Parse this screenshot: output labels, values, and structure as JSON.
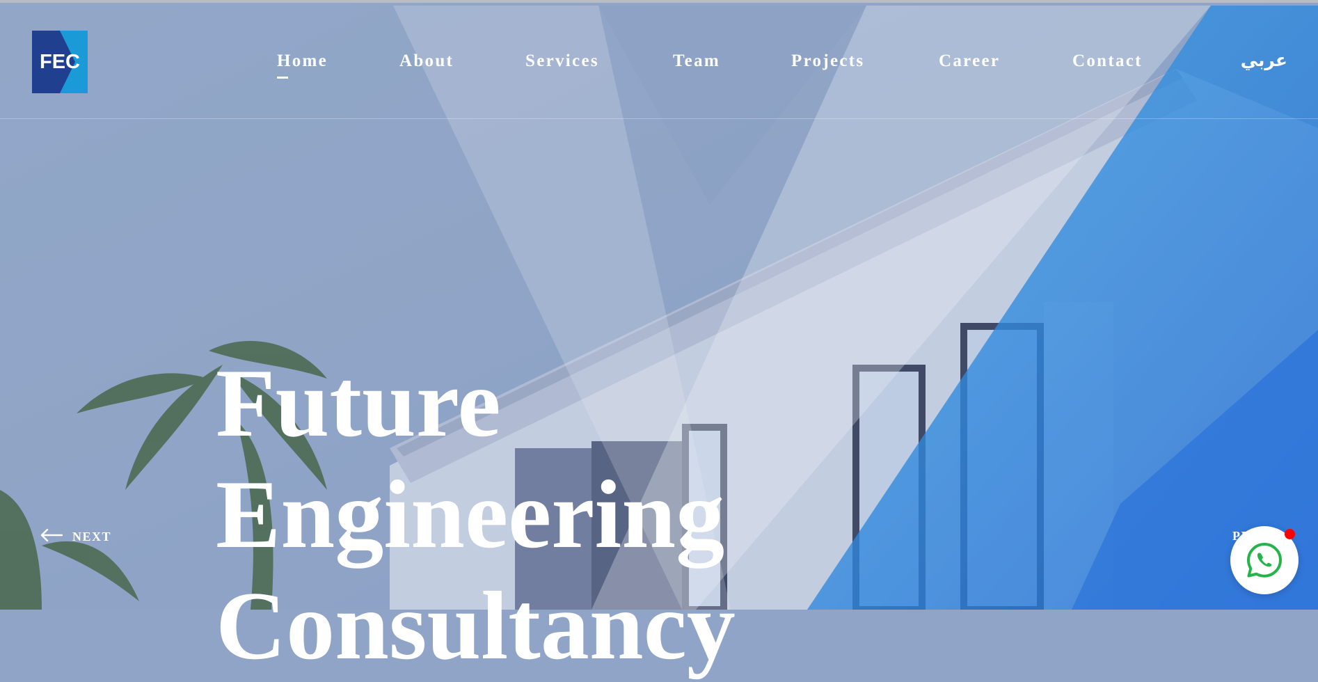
{
  "brand": {
    "logo_text": "FEC"
  },
  "nav": {
    "items": [
      {
        "label": "Home",
        "active": true
      },
      {
        "label": "About"
      },
      {
        "label": "Services"
      },
      {
        "label": "Team"
      },
      {
        "label": "Projects"
      },
      {
        "label": "Career"
      },
      {
        "label": "Contact"
      }
    ],
    "language_toggle": "عربي"
  },
  "hero": {
    "headline_lines": [
      "Future",
      "Engineering",
      "Consultancy"
    ]
  },
  "slider": {
    "prev_label": "NEXT",
    "next_label": "PREV"
  },
  "colors": {
    "overlay": "#8fa4c6",
    "accent_blue": "#1d7fe6",
    "logo_dark": "#213f8f",
    "logo_light": "#1a9ad6"
  },
  "icons": {
    "prev_arrow": "arrow-left-icon",
    "whatsapp": "whatsapp-icon"
  }
}
